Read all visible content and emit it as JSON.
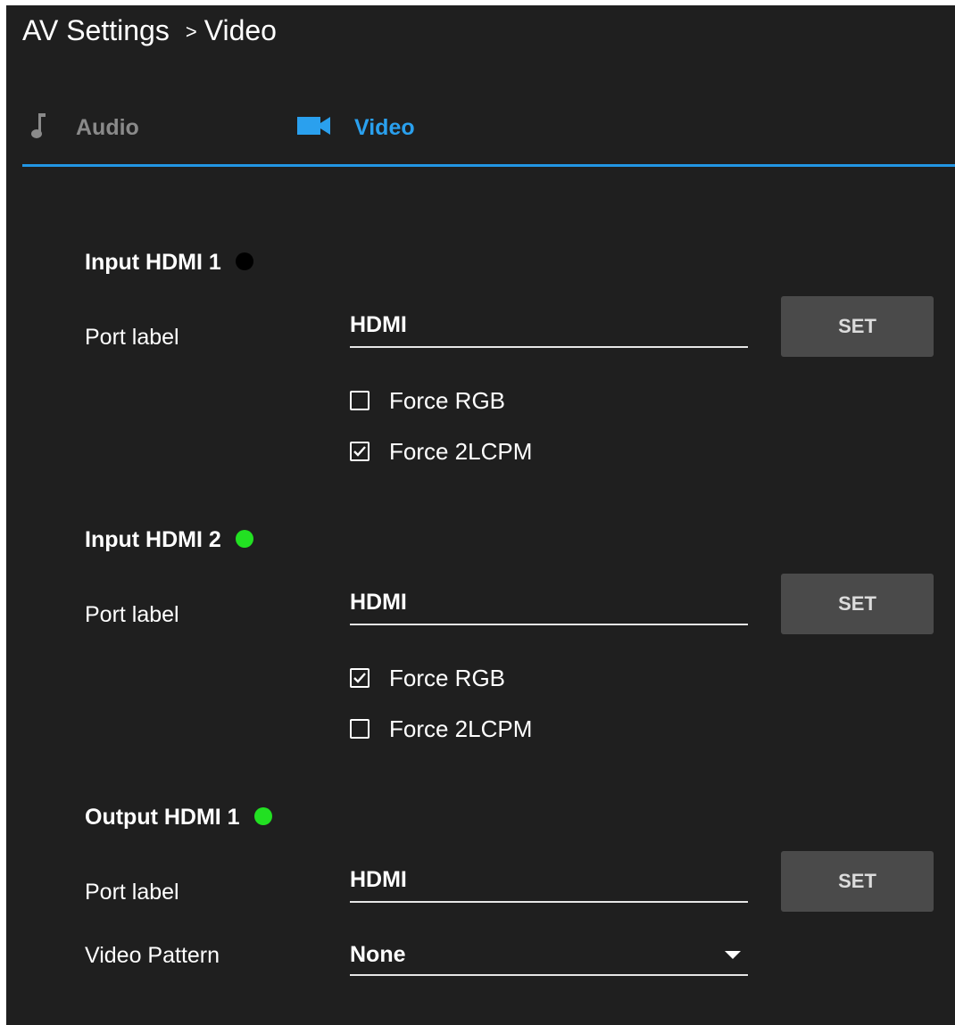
{
  "breadcrumb": {
    "root": "AV Settings",
    "separator": ">",
    "current": "Video"
  },
  "tabs": [
    {
      "label": "Audio",
      "icon": "music-note-icon",
      "active": false
    },
    {
      "label": "Video",
      "icon": "video-camera-icon",
      "active": true
    }
  ],
  "colors": {
    "accent": "#2296e4",
    "inactive_tab": "#8a8a8a",
    "status_off": "#000000",
    "status_on": "#22e022"
  },
  "sections": [
    {
      "title": "Input HDMI 1",
      "status": "off",
      "port_label_caption": "Port label",
      "port_label_value": "HDMI",
      "set_label": "SET",
      "options": [
        {
          "label": "Force RGB",
          "checked": false
        },
        {
          "label": "Force 2LCPM",
          "checked": true
        }
      ]
    },
    {
      "title": "Input HDMI 2",
      "status": "on",
      "port_label_caption": "Port label",
      "port_label_value": "HDMI",
      "set_label": "SET",
      "options": [
        {
          "label": "Force RGB",
          "checked": true
        },
        {
          "label": "Force 2LCPM",
          "checked": false
        }
      ]
    },
    {
      "title": "Output HDMI 1",
      "status": "on",
      "port_label_caption": "Port label",
      "port_label_value": "HDMI",
      "set_label": "SET",
      "video_pattern_caption": "Video Pattern",
      "video_pattern_value": "None"
    }
  ]
}
